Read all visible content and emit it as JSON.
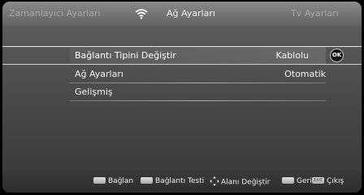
{
  "tabs": {
    "left": "Zamanlayıcı Ayarları",
    "center": "Ağ Ayarları",
    "right": "Tv Ayarları"
  },
  "menu": {
    "items": [
      {
        "label": "Bağlantı Tipini Değiştir",
        "value": "Kablolu",
        "selected": true,
        "button": "OK"
      },
      {
        "label": "Ağ Ayarları",
        "value": "Otomatik"
      },
      {
        "label": "Gelişmiş",
        "value": ""
      }
    ]
  },
  "footer": {
    "connect": "Bağlan",
    "test": "Bağlantı Testi",
    "change_area": "Alanı Değiştir",
    "back": "Geri",
    "exit_key": "EXIT",
    "exit": "Çıkış"
  },
  "colors": {
    "selected_row": "#ffffff",
    "text": "#f4f4f4",
    "inactive_tab": "#a9a9a9"
  },
  "icons": [
    "wifi-icon",
    "ok-button-icon",
    "red-key-icon",
    "green-key-icon",
    "navigation-dpad-icon",
    "back-key-icon",
    "exit-key-icon"
  ]
}
